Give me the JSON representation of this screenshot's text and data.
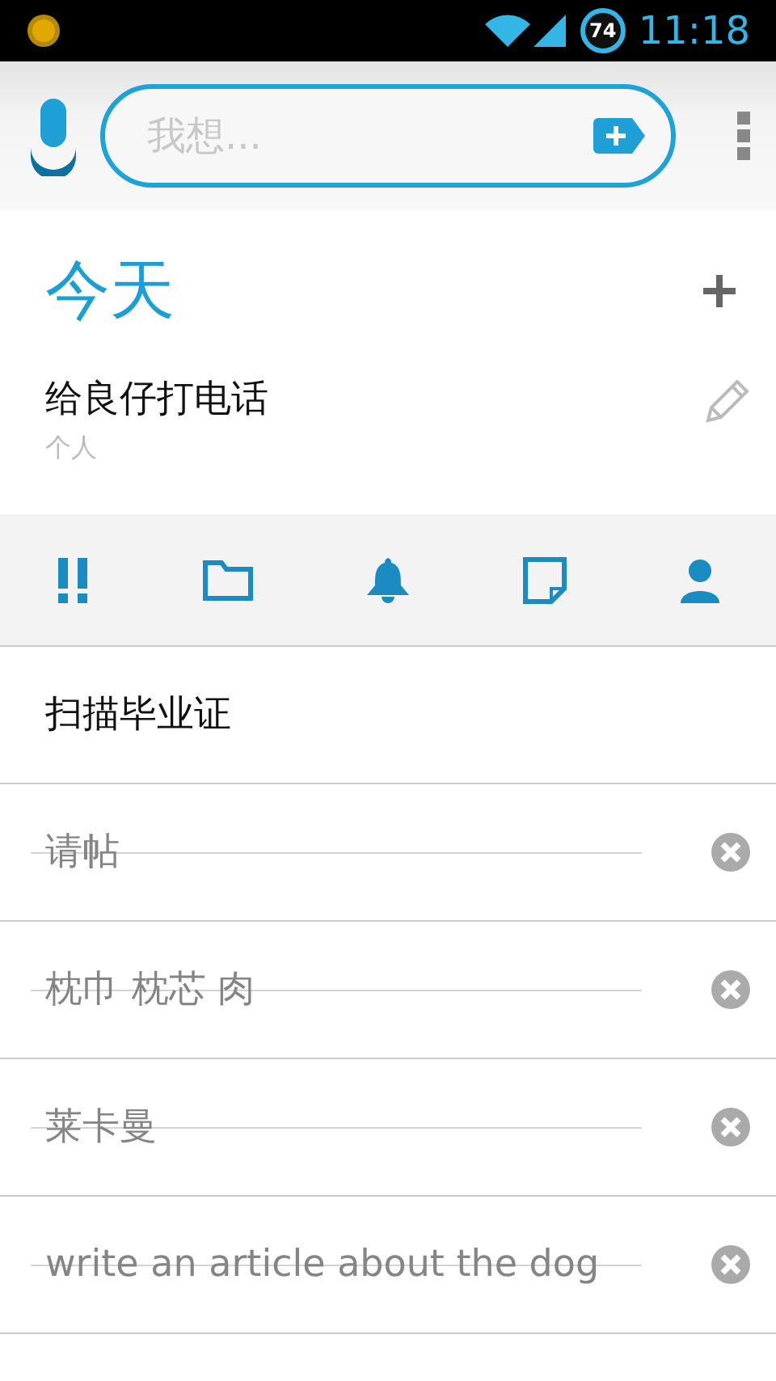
{
  "status_bar": {
    "battery": "74",
    "time": "11:18"
  },
  "search": {
    "placeholder": "我想..."
  },
  "section": {
    "title": "今天"
  },
  "expanded_task": {
    "title": "给良仔打电话",
    "category": "个人",
    "expanded": true
  },
  "tasks": [
    {
      "title": "扫描毕业证",
      "done": false
    },
    {
      "title": "请帖",
      "done": true
    },
    {
      "title": "枕巾 枕芯 肉",
      "done": true
    },
    {
      "title": "莱卡曼",
      "done": true
    },
    {
      "title": "write an article about the dog",
      "done": true
    }
  ]
}
